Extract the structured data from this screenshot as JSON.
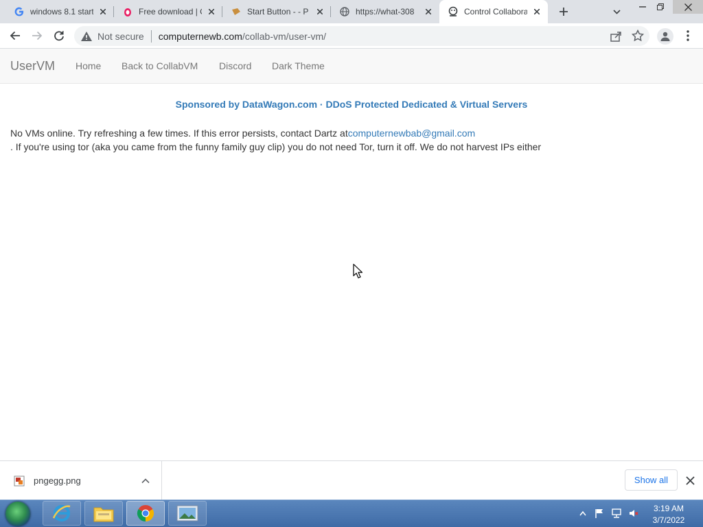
{
  "browser": {
    "tabs": [
      {
        "title": "windows 8.1 start",
        "icon": "google-icon",
        "active": false
      },
      {
        "title": "Free download | C",
        "icon": "pngegg-icon",
        "active": false
      },
      {
        "title": "Start Button - - P",
        "icon": "bookmark-icon",
        "active": false
      },
      {
        "title": "https://what-308",
        "icon": "globe-icon",
        "active": false
      },
      {
        "title": "Control Collabora",
        "icon": "collabvm-icon",
        "active": true
      }
    ],
    "security_label": "Not secure",
    "url_host": "computernewb.com",
    "url_path": "/collab-vm/user-vm/"
  },
  "page": {
    "brand": "UserVM",
    "nav": [
      "Home",
      "Back to CollabVM",
      "Discord",
      "Dark Theme"
    ],
    "sponsor": "Sponsored by DataWagon.com · DDoS Protected Dedicated & Virtual Servers",
    "message_prefix": "No VMs online. Try refreshing a few times. If this error persists, contact Dartz at",
    "contact_email": "computernewbab@gmail.com",
    "message_suffix": ". If you're using tor (aka you came from the funny family guy clip) you do not need Tor, turn it off. We do not harvest IPs either"
  },
  "downloads": {
    "file_name": "pngegg.png",
    "show_all_label": "Show all"
  },
  "taskbar": {
    "apps": [
      "internet-explorer-icon",
      "file-explorer-icon",
      "chrome-icon",
      "photo-viewer-icon"
    ],
    "time": "3:19 AM",
    "date": "3/7/2022"
  },
  "colors": {
    "link": "#337ab7",
    "navbar_bg": "#f8f8f8",
    "tabstrip_bg": "#dee1e6"
  }
}
